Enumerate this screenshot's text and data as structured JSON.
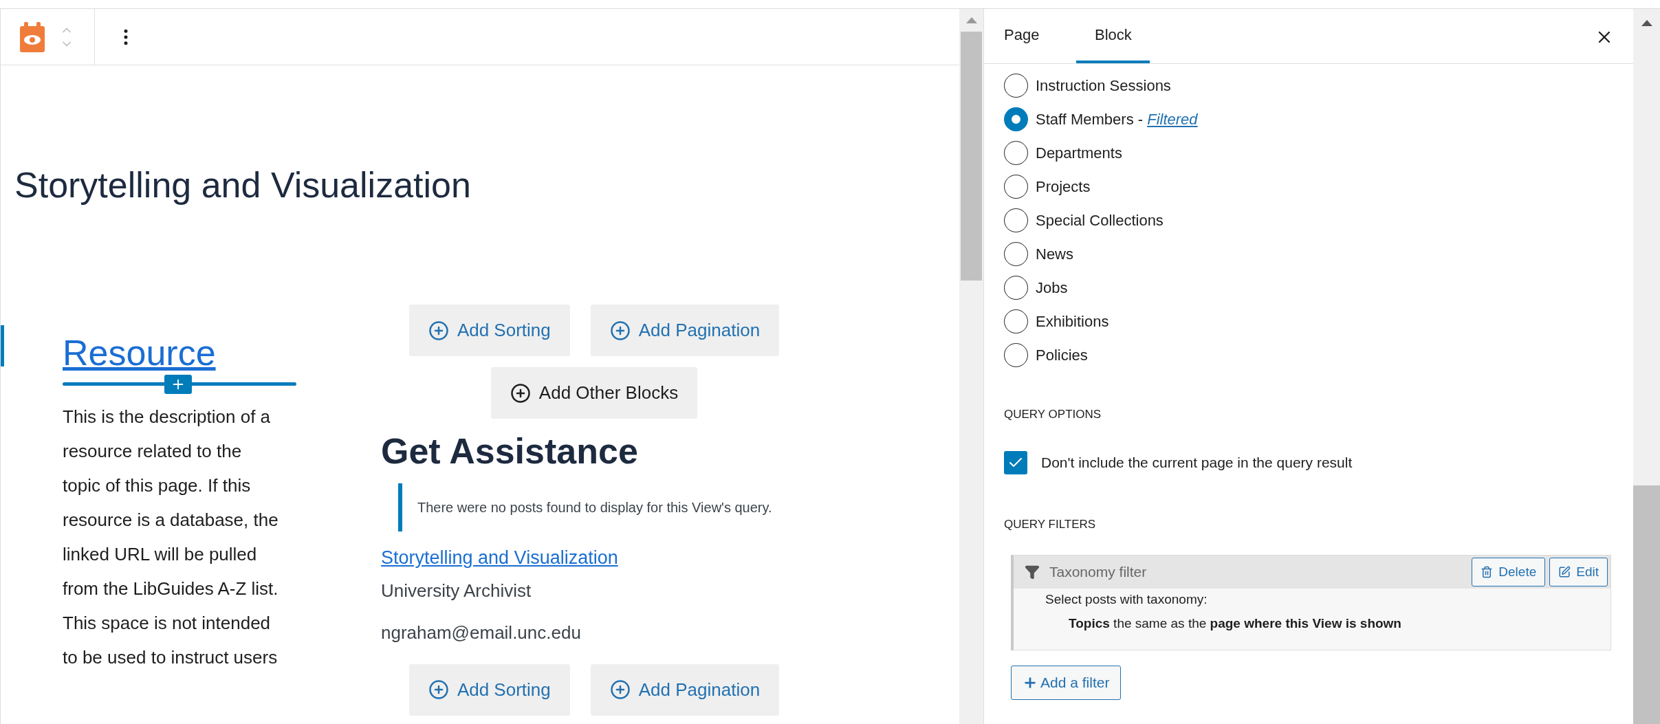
{
  "editor": {
    "heading": "Storytelling and Visualization",
    "resource": {
      "link": "Resource",
      "description": [
        "This is the description of a",
        "resource related to the",
        "topic of this page. If this",
        "resource is a database, the",
        "linked URL will be pulled",
        "from the LibGuides A-Z list.",
        "This space is not intended",
        "to be used to instruct users"
      ]
    },
    "top_buttons": [
      "Add Sorting",
      "Add Pagination"
    ],
    "other_blocks_button": "Add Other Blocks",
    "section_heading": "Get Assistance",
    "notice": "There were no posts found to display for this View's query.",
    "staff": {
      "link": "Storytelling and Visualization",
      "title": "University Archivist",
      "email": "ngraham@email.unc.edu"
    },
    "bottom_buttons": [
      "Add Sorting",
      "Add Pagination"
    ]
  },
  "sidebar": {
    "tabs": [
      {
        "label": "Page",
        "selected": false
      },
      {
        "label": "Block",
        "selected": true
      }
    ],
    "post_types": [
      {
        "label": "Instruction Sessions",
        "selected": false
      },
      {
        "label": "Staff Members - ",
        "link": "Filtered",
        "selected": true
      },
      {
        "label": "Departments",
        "selected": false
      },
      {
        "label": "Projects",
        "selected": false
      },
      {
        "label": "Special Collections",
        "selected": false
      },
      {
        "label": "News",
        "selected": false
      },
      {
        "label": "Jobs",
        "selected": false
      },
      {
        "label": "Exhibitions",
        "selected": false
      },
      {
        "label": "Policies",
        "selected": false
      }
    ],
    "query_options": {
      "heading": "QUERY OPTIONS",
      "checkbox": {
        "label": "Don't include the current page in the query result",
        "checked": true
      }
    },
    "query_filters": {
      "heading": "QUERY FILTERS",
      "filter": {
        "title": "Taxonomy filter",
        "delete": "Delete",
        "edit": "Edit",
        "line1": "Select posts with taxonomy:",
        "line2": "**Topics** the same as the **page where this View is shown**"
      },
      "add_button": "Add a filter"
    }
  }
}
